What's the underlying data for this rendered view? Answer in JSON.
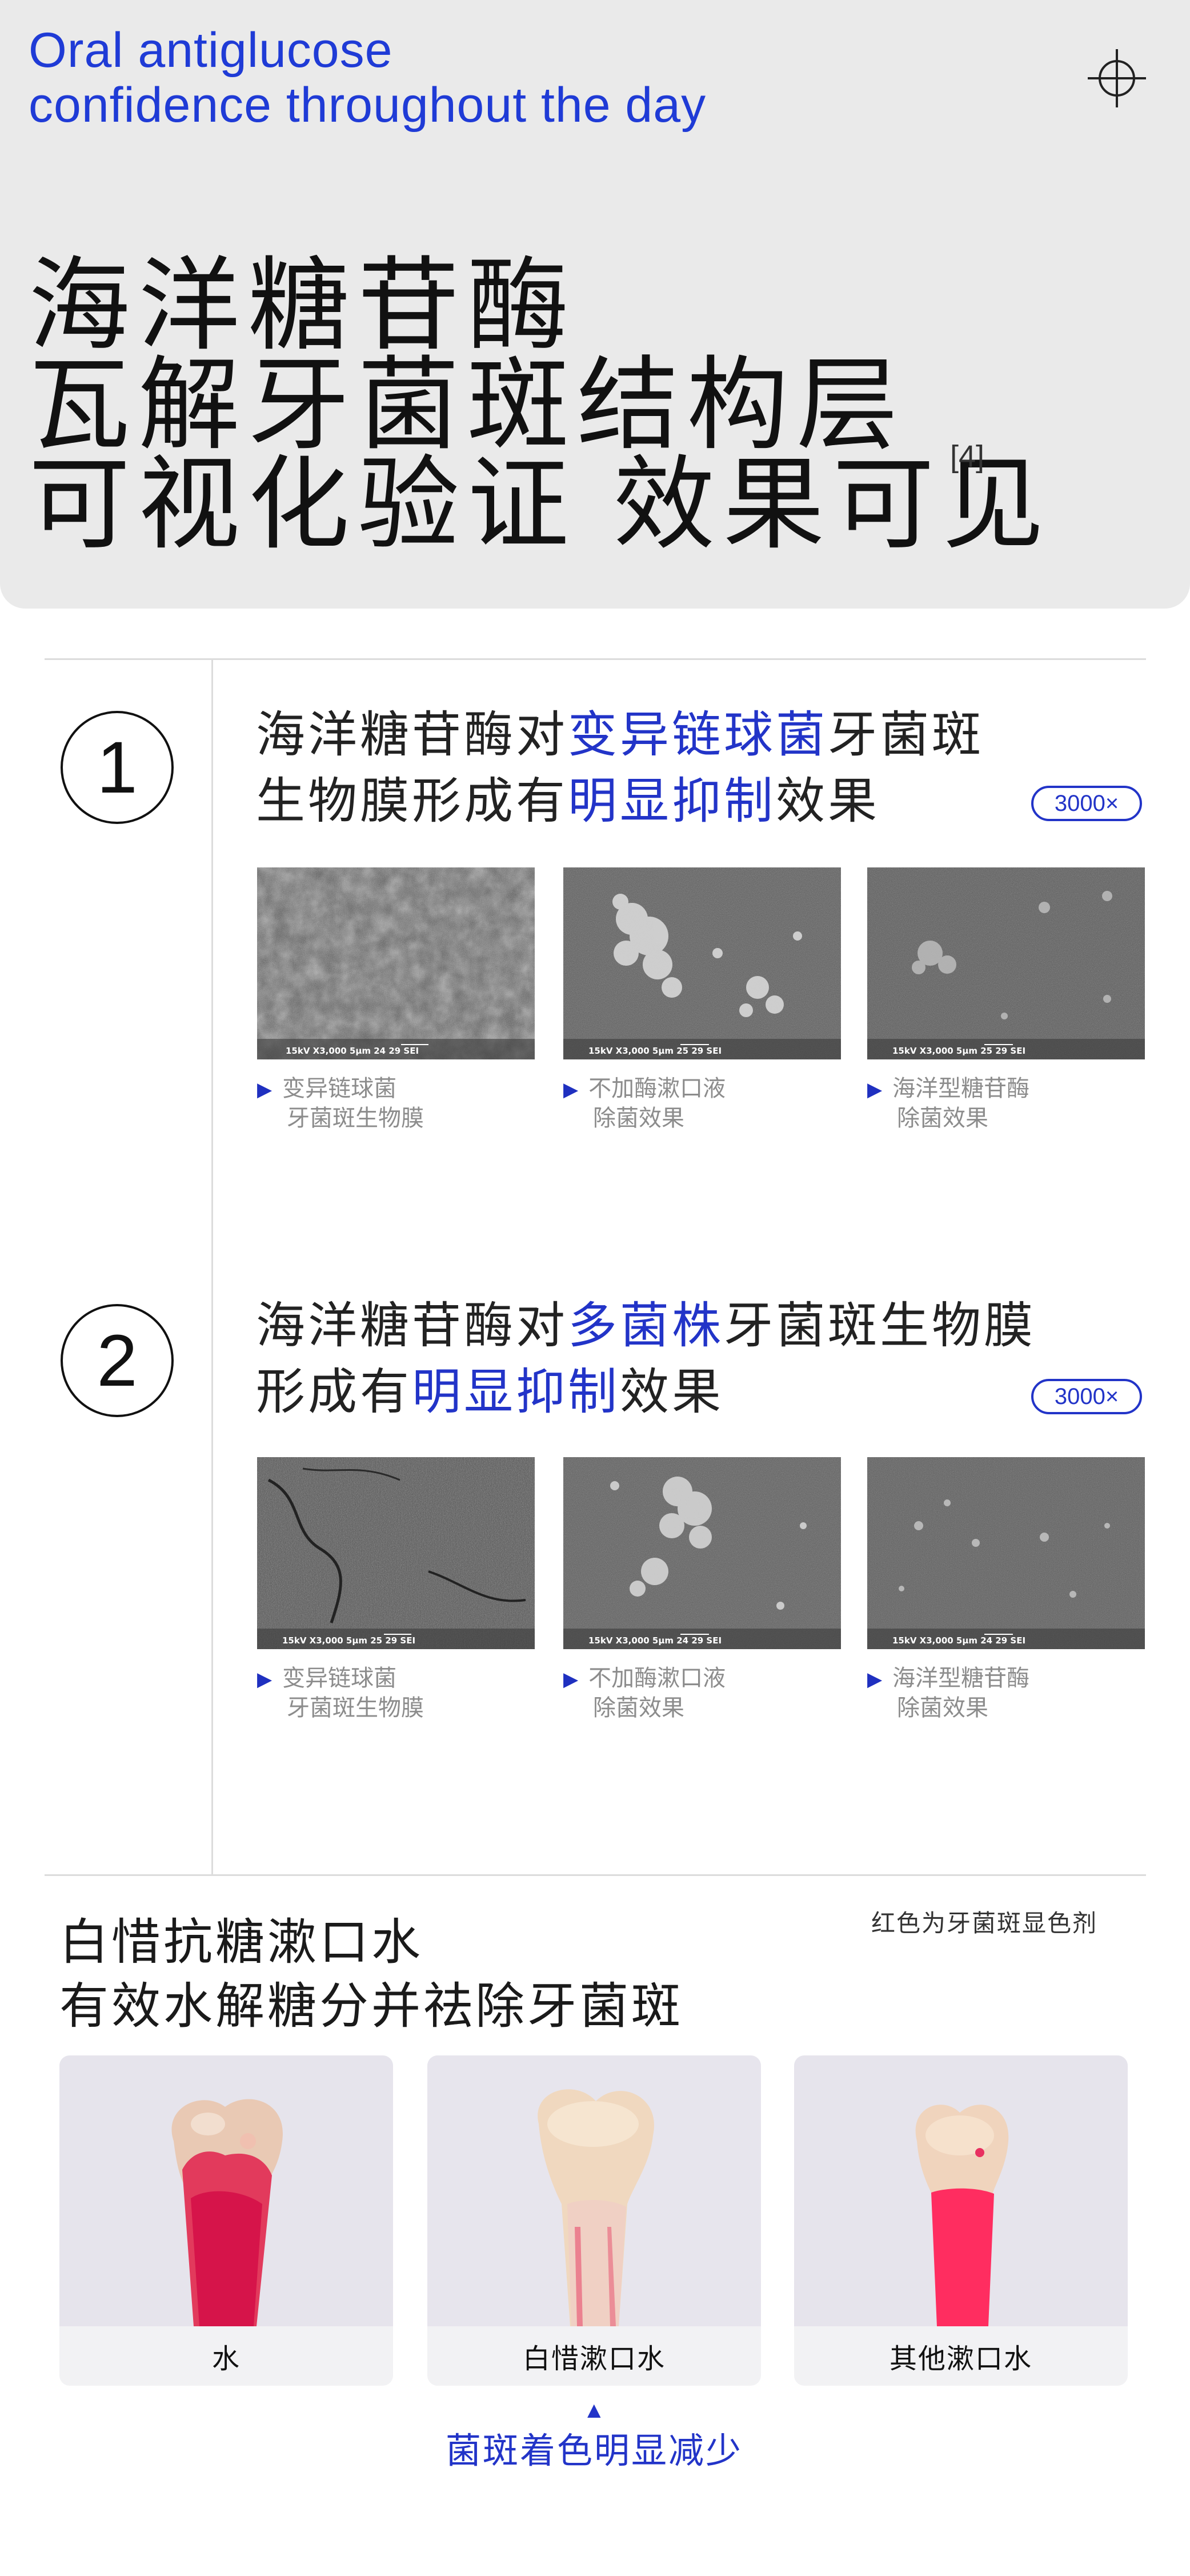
{
  "header": {
    "english_line1": "Oral antiglucose",
    "english_line2": "confidence throughout the day",
    "headline_line1": "海洋糖苷酶",
    "headline_line2": "瓦解牙菌斑结构层",
    "headline_line3": "可视化验证 效果可见",
    "reference": "[4]",
    "icon": "crosshair-icon"
  },
  "section1": {
    "number": "1",
    "title_l1_a": "海洋糖苷酶对",
    "title_l1_b": "变异链球菌",
    "title_l1_c": "牙菌斑",
    "title_l2_a": "生物膜形成有",
    "title_l2_b": "明显抑制",
    "title_l2_c": "效果",
    "magnification": "3000×",
    "images": [
      {
        "info": "15kV   X3,000   5μm          24 29 SEI",
        "caption_l1": "变异链球菌",
        "caption_l2": "牙菌斑生物膜"
      },
      {
        "info": "15kV   X3,000   5μm          25 29 SEI",
        "caption_l1": "不加酶漱口液",
        "caption_l2": "除菌效果"
      },
      {
        "info": "15kV   X3,000   5μm          25 29 SEI",
        "caption_l1": "海洋型糖苷酶",
        "caption_l2": "除菌效果"
      }
    ]
  },
  "section2": {
    "number": "2",
    "title_l1_a": "海洋糖苷酶对",
    "title_l1_b": "多菌株",
    "title_l1_c": "牙菌斑生物膜",
    "title_l2_a": "形成有",
    "title_l2_b": "明显抑制",
    "title_l2_c": "效果",
    "magnification": "3000×",
    "images": [
      {
        "info": "15kV   X3,000   5μm          25 29 SEI",
        "caption_l1": "变异链球菌",
        "caption_l2": "牙菌斑生物膜"
      },
      {
        "info": "15kV   X3,000   5μm          24 29 SEI",
        "caption_l1": "不加酶漱口液",
        "caption_l2": "除菌效果"
      },
      {
        "info": "15kV   X3,000   5μm          24 29 SEI",
        "caption_l1": "海洋型糖苷酶",
        "caption_l2": "除菌效果"
      }
    ]
  },
  "mouthwash": {
    "title_l1": "白惜抗糖漱口水",
    "title_l2": "有效水解糖分并祛除牙菌斑",
    "note": "红色为牙菌斑显色剂",
    "labels": [
      "水",
      "白惜漱口水",
      "其他漱口水"
    ],
    "arrow": "▲",
    "result": "菌斑着色明显减少"
  },
  "colors": {
    "accent_blue": "#2234c8",
    "header_bg": "#eaeaea",
    "stain_red": "#e8224a"
  }
}
